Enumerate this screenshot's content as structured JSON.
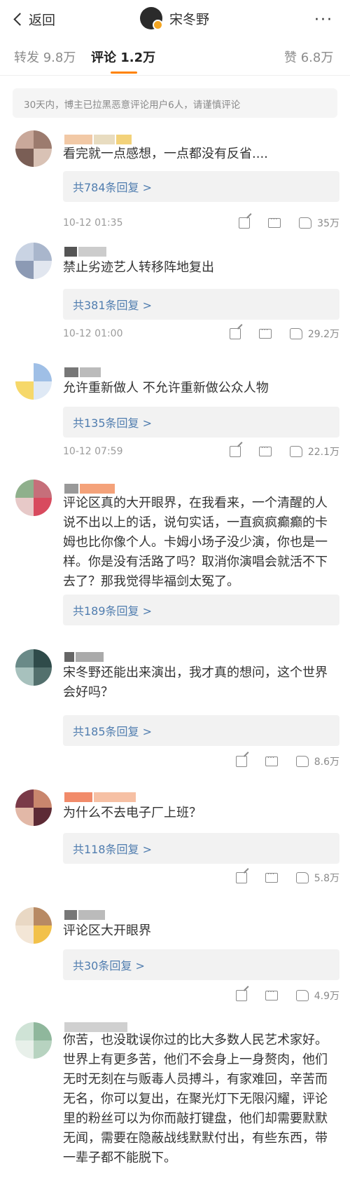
{
  "header": {
    "back_label": "返回",
    "title": "宋冬野",
    "more": "···"
  },
  "tabs": [
    {
      "label": "转发",
      "count": "9.8万",
      "active": false
    },
    {
      "label": "评论",
      "count": "1.2万",
      "active": true
    },
    {
      "label": "赞",
      "count": "6.8万",
      "active": false
    }
  ],
  "accent_color": "#ff8200",
  "link_color": "#507daf",
  "notice": "30天内，博主已拉黑恶意评论用户6人，请谨慎评论",
  "comments": [
    {
      "text": "看完就一点感想，一点都没有反省....",
      "replies": "共784条回复 >",
      "time": "10-12 01:35",
      "likes": "35万"
    },
    {
      "text": "禁止劣迹艺人转移阵地复出",
      "replies": "共381条回复 >",
      "time": "10-12 01:00",
      "likes": "29.2万"
    },
    {
      "text": "允许重新做人 不允许重新做公众人物",
      "replies": "共135条回复 >",
      "time": "10-12 07:59",
      "likes": "22.1万"
    },
    {
      "text": "评论区真的大开眼界，在我看来，一个清醒的人说不出以上的话，说句实话，一直疯疯癫癫的卡姆也比你像个人。卡姆小场子没少演，你也是一样。你是没有活路了吗？取消你演唱会就活不下去了？那我觉得毕福剑太冤了。",
      "replies": "共189条回复 >",
      "time": "",
      "likes": ""
    },
    {
      "text": "宋冬野还能出来演出，我才真的想问，这个世界会好吗？",
      "replies": "共185条回复 >",
      "time": "",
      "likes": "8.6万"
    },
    {
      "text": "为什么不去电子厂上班？",
      "replies": "共118条回复 >",
      "time": "",
      "likes": "5.8万"
    },
    {
      "text": "评论区大开眼界",
      "replies": "共30条回复 >",
      "time": "",
      "likes": "4.9万"
    },
    {
      "text": "你苦，也没耽误你过的比大多数人民艺术家好。世界上有更多苦，他们不会身上一身赘肉，他们无时无刻在与贩毒人员搏斗，有家难回，辛苦而无名，你可以复出，在聚光灯下无限闪耀，评论里的粉丝可以为你而敲打键盘，他们却需要默默无闻，需要在隐蔽战线默默付出，有些东西，带一辈子都不能脱下。",
      "replies": "",
      "time": "",
      "likes": ""
    }
  ]
}
